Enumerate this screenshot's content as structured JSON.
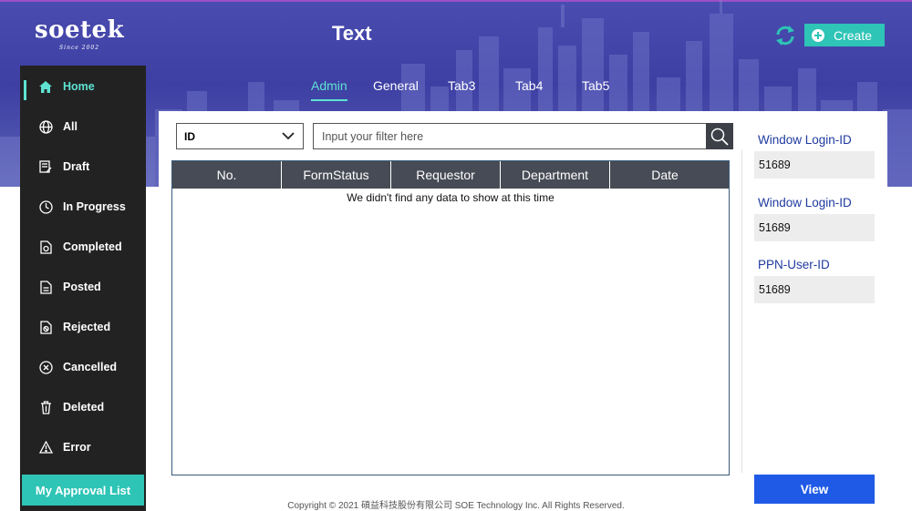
{
  "brand": {
    "name": "soetek",
    "tagline": "Since 2002"
  },
  "header": {
    "title": "Text",
    "create_label": "Create"
  },
  "tabs": [
    {
      "label": "Admin",
      "active": true
    },
    {
      "label": "General",
      "active": false
    },
    {
      "label": "Tab3",
      "active": false
    },
    {
      "label": "Tab4",
      "active": false
    },
    {
      "label": "Tab5",
      "active": false
    }
  ],
  "sidebar": {
    "items": [
      {
        "label": "Home",
        "icon": "home-icon",
        "active": true
      },
      {
        "label": "All",
        "icon": "globe-icon"
      },
      {
        "label": "Draft",
        "icon": "draft-icon"
      },
      {
        "label": "In Progress",
        "icon": "progress-icon"
      },
      {
        "label": "Completed",
        "icon": "completed-icon"
      },
      {
        "label": "Posted",
        "icon": "document-icon"
      },
      {
        "label": "Rejected",
        "icon": "rejected-icon"
      },
      {
        "label": "Cancelled",
        "icon": "cancelled-icon"
      },
      {
        "label": "Deleted",
        "icon": "trash-icon"
      },
      {
        "label": "Error",
        "icon": "warning-icon"
      }
    ],
    "approval_label": "My Approval List"
  },
  "filter": {
    "field_value": "ID",
    "placeholder": "Input your filter here",
    "search_icon": "search-icon"
  },
  "table": {
    "columns": [
      "No.",
      "FormStatus",
      "Requestor",
      "Department",
      "Date"
    ],
    "rows": [],
    "empty_message": "We didn't find any data to show at this time"
  },
  "info_panel": [
    {
      "label": "Window Login-ID",
      "value": "51689"
    },
    {
      "label": "Window Login-ID",
      "value": "51689"
    },
    {
      "label": "PPN-User-ID",
      "value": "51689"
    }
  ],
  "view_label": "View",
  "footer": {
    "copyright": "Copyright © 2021 碩益科技股份有限公司 SOE Technology Inc. All Rights Reserved."
  },
  "colors": {
    "accent": "#2ec4b6",
    "active_text": "#5ee3d2",
    "primary_blue": "#1f5ae6",
    "sidebar_bg": "#222222",
    "header_bg": "#3d3fa3"
  }
}
